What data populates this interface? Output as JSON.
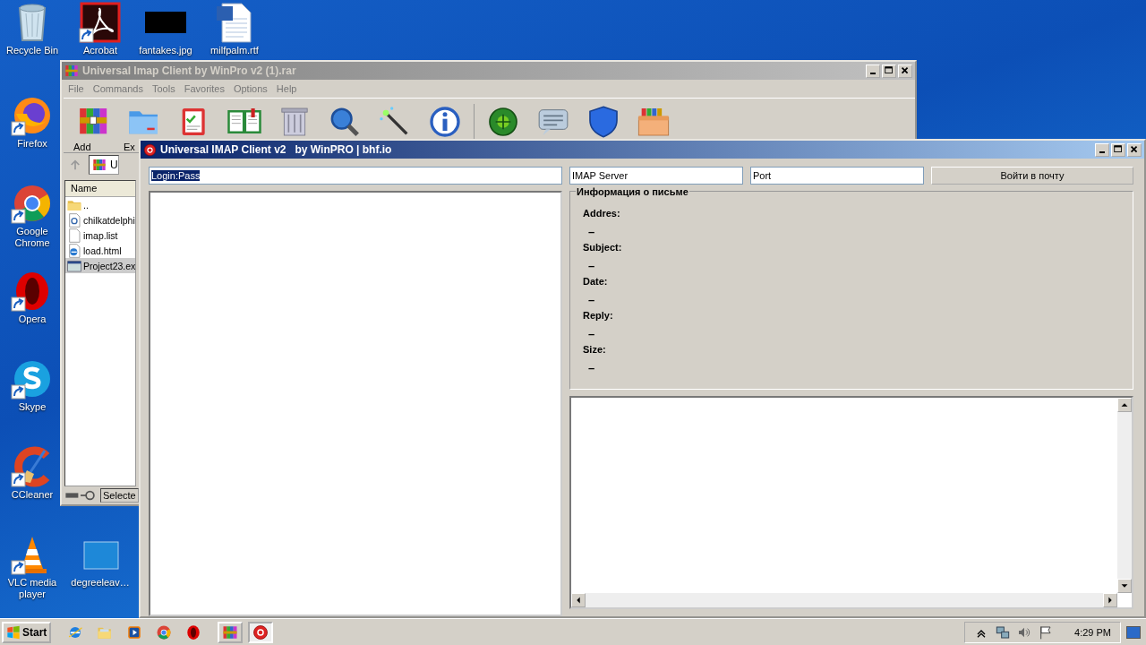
{
  "desktop": {
    "icons": [
      {
        "label": "Recycle Bin",
        "kind": "recycle",
        "shortcut": false
      },
      {
        "label": "Acrobat",
        "kind": "acrobat",
        "shortcut": true
      },
      {
        "label": "fantakes.jpg",
        "kind": "image",
        "shortcut": false
      },
      {
        "label": "milfpalm.rtf",
        "kind": "word",
        "shortcut": false
      },
      {
        "label": "Firefox",
        "kind": "firefox",
        "shortcut": true
      },
      {
        "label": "Google Chrome",
        "kind": "chrome",
        "shortcut": true
      },
      {
        "label": "Opera",
        "kind": "opera",
        "shortcut": true
      },
      {
        "label": "Skype",
        "kind": "skype",
        "shortcut": true
      },
      {
        "label": "CCleaner",
        "kind": "ccleaner",
        "shortcut": true
      },
      {
        "label": "VLC media player",
        "kind": "vlc",
        "shortcut": true
      },
      {
        "label": "degreeleav…",
        "kind": "blank",
        "shortcut": false
      }
    ]
  },
  "winrar_window": {
    "title": "Universal Imap Client by WinPro v2 (1).rar",
    "active": false,
    "menu": [
      "File",
      "Commands",
      "Tools",
      "Favorites",
      "Options",
      "Help"
    ],
    "toolbar": [
      {
        "kind": "add",
        "label": "Add"
      },
      {
        "kind": "extract",
        "label": "Ex"
      },
      {
        "kind": "test"
      },
      {
        "kind": "view"
      },
      {
        "kind": "delete"
      },
      {
        "kind": "find"
      },
      {
        "kind": "wizard"
      },
      {
        "kind": "info"
      },
      {
        "kind": "separator"
      },
      {
        "kind": "virus"
      },
      {
        "kind": "comment"
      },
      {
        "kind": "protect"
      },
      {
        "kind": "sfx"
      }
    ],
    "address": "U",
    "column": "Name",
    "files": [
      {
        "name": "..",
        "kind": "folder",
        "selected": false
      },
      {
        "name": "chilkatdelphi",
        "kind": "dll",
        "selected": false
      },
      {
        "name": "imap.list",
        "kind": "file",
        "selected": false
      },
      {
        "name": "load.html",
        "kind": "html",
        "selected": false
      },
      {
        "name": "Project23.ex",
        "kind": "exe",
        "selected": true
      }
    ],
    "status": "Selecte"
  },
  "imap_window": {
    "title": "Universal IMAP Client v2   by WinPRO | bhf.io",
    "active": true,
    "login_field": {
      "value": "Login:Pass",
      "highlighted": true
    },
    "server_field": {
      "value": "IMAP Server"
    },
    "port_field": {
      "value": "Port"
    },
    "login_button": "Войти в почту",
    "info": {
      "title": "Информация о письме",
      "fields": [
        {
          "label": "Addres:",
          "value": "–"
        },
        {
          "label": "Subject:",
          "value": "–"
        },
        {
          "label": "Date:",
          "value": "–"
        },
        {
          "label": "Reply:",
          "value": "–"
        },
        {
          "label": "Size:",
          "value": "–"
        }
      ]
    }
  },
  "taskbar": {
    "start": "Start",
    "quick_launch": [
      {
        "kind": "ie"
      },
      {
        "kind": "explorer"
      },
      {
        "kind": "media"
      },
      {
        "kind": "chrome"
      },
      {
        "kind": "opera"
      }
    ],
    "tasks": [
      {
        "kind": "winrar",
        "selected": false
      },
      {
        "kind": "imap",
        "selected": true
      }
    ],
    "tray": [
      {
        "kind": "chevron"
      },
      {
        "kind": "network"
      },
      {
        "kind": "volume"
      },
      {
        "kind": "flag"
      }
    ],
    "clock": "4:29 PM"
  }
}
